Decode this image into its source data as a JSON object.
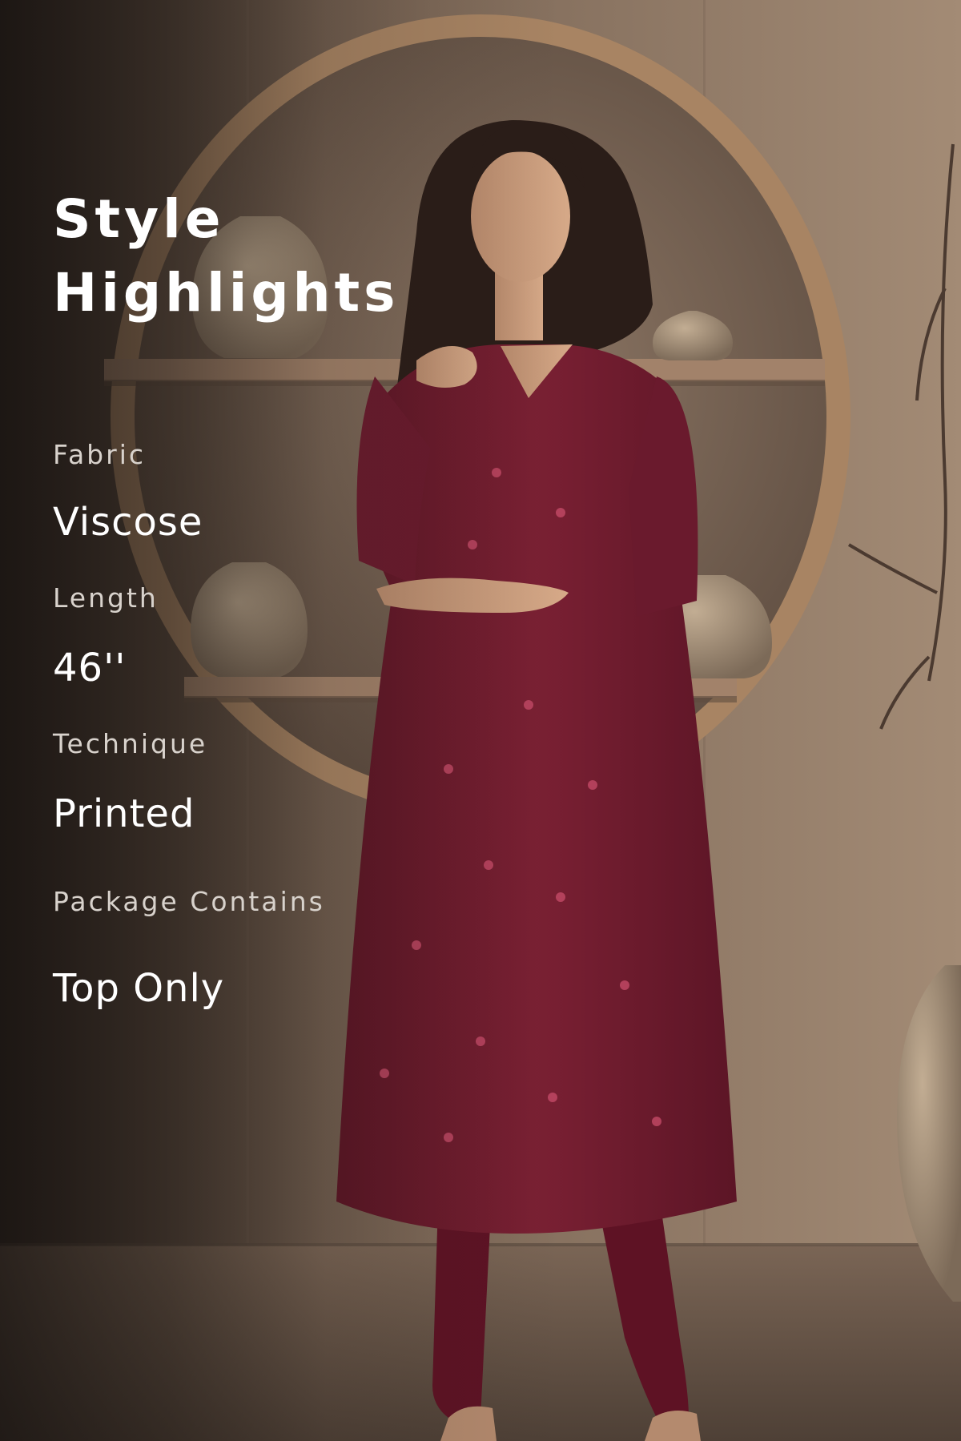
{
  "heading": {
    "line1": "Style",
    "line2": "Highlights"
  },
  "specs": [
    {
      "label": "Fabric",
      "value": "Viscose"
    },
    {
      "label": "Length",
      "value": "46''"
    },
    {
      "label": "Technique",
      "value": "Printed"
    },
    {
      "label": "Package Contains",
      "value": "Top Only"
    }
  ],
  "colors": {
    "wall": "#8f7866",
    "shelf_wood": "#a07e61",
    "kurta": "#6e1a2c",
    "leggings": "#5e1224",
    "text": "#ffffff",
    "label_text": "#d8d2cc"
  }
}
